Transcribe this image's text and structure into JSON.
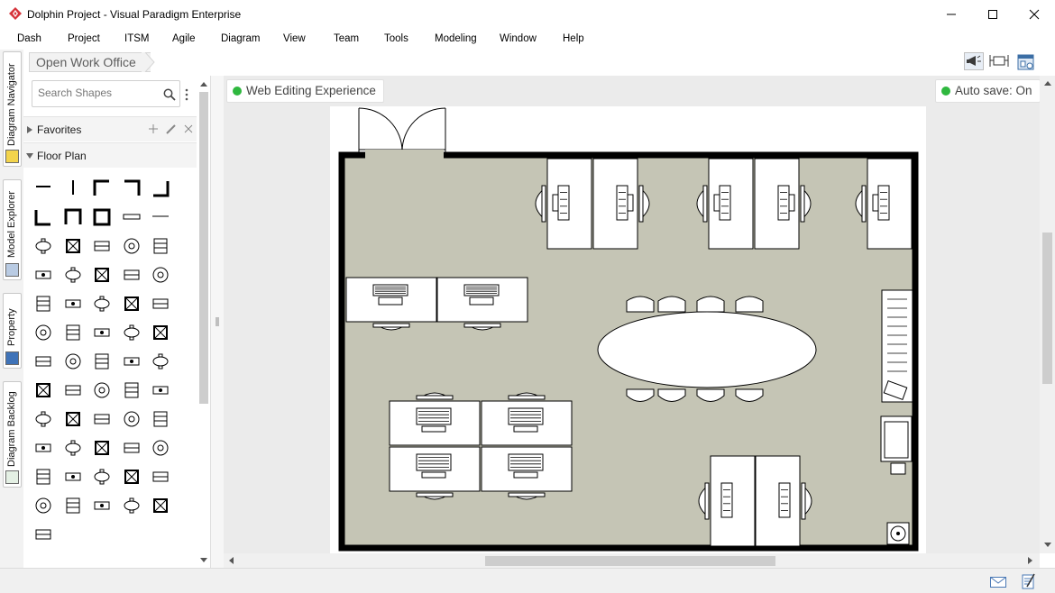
{
  "window": {
    "title": "Dolphin Project - Visual Paradigm Enterprise",
    "logo_icon": "visual-paradigm-logo-icon",
    "accent_color": "#d6343b",
    "controls": [
      "minimize-icon",
      "maximize-icon",
      "close-icon"
    ]
  },
  "menu": {
    "items": [
      "Dash",
      "Project",
      "ITSM",
      "Agile",
      "Diagram",
      "View",
      "Team",
      "Tools",
      "Modeling",
      "Window",
      "Help"
    ]
  },
  "breadcrumb": {
    "label": "Open Work Office"
  },
  "side_tabs": [
    {
      "label": "Diagram Navigator",
      "icon": "diagram-navigator-icon"
    },
    {
      "label": "Model Explorer",
      "icon": "model-explorer-icon"
    },
    {
      "label": "Property",
      "icon": "property-icon"
    },
    {
      "label": "Diagram Backlog",
      "icon": "diagram-backlog-icon"
    }
  ],
  "shape_panel": {
    "search_placeholder": "Search Shapes",
    "favorites_label": "Favorites",
    "floor_plan_label": "Floor Plan",
    "shape_icons": [
      "wall-icon",
      "wall-vertical-icon",
      "wall-corner-tl-icon",
      "wall-corner-tr-icon",
      "wall-corner-br-icon",
      "wall-corner-bl-icon",
      "wall-u-icon",
      "room-icon",
      "window-icon",
      "thin-wall-icon",
      "wall-segment-icon",
      "stairs-icon",
      "ladder-icon",
      "shelf-icon",
      "door-swing-icon",
      "double-door-icon",
      "bay-window-icon",
      "cabinet-icon",
      "bookcase-icon",
      "locker-icon",
      "counter-icon",
      "stool-icon",
      "tv-stand-icon",
      "file-cabinet-icon",
      "printer-icon",
      "l-wall-icon",
      "l-desk-icon",
      "monitor-icon",
      "crossed-box-icon",
      "envelope-icon",
      "pipe-icon",
      "plant-icon",
      "computer-icon",
      "bin-icon",
      "piano-icon",
      "flower-icon",
      "chair-icon",
      "stove-icon",
      "cooktop-icon",
      "sofa-icon",
      "sink-icon",
      "basin-icon",
      "double-sink-icon",
      "tub-icon",
      "shower-icon",
      "round-table-icon",
      "rect-table-icon",
      "toilet-icon",
      "disc-icon",
      "server-icon",
      "dining-chair-icon",
      "table-4-icon",
      "round-table-4-icon",
      "oval-table-icon",
      "long-table-icon",
      "desk-chair-icon",
      "square-table-icon",
      "table-6-icon",
      "oval-table-6-icon",
      "oval-table-8-icon",
      "rug-icon"
    ]
  },
  "canvas": {
    "web_editing_label": "Web Editing Experience",
    "auto_save_label": "Auto save: On",
    "status_color": "#2fb83f",
    "floor_color": "#c5c5b5",
    "wall_color": "#000000"
  },
  "toolbar_icons": [
    "megaphone-icon",
    "fit-diagram-icon",
    "layout-icon"
  ],
  "status_icons": [
    "mail-icon",
    "notes-icon"
  ]
}
